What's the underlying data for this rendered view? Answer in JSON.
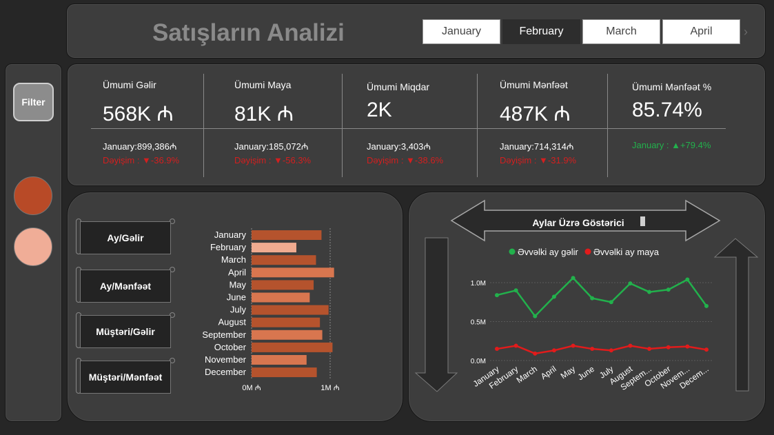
{
  "header": {
    "title": "Satışların Analizi",
    "tabs": [
      {
        "label": "January",
        "active": false
      },
      {
        "label": "February",
        "active": true
      },
      {
        "label": "March",
        "active": false
      },
      {
        "label": "April",
        "active": false
      }
    ],
    "next_icon": "›"
  },
  "sidebar": {
    "filter_label": "Filter",
    "circle_colors": [
      "#b84a27",
      "#f0ad97"
    ]
  },
  "kpis": [
    {
      "title": "Ümumi Gəlir",
      "value": "568K ₼",
      "prev": "January:899,386₼",
      "change": "Dəyişim : ▼-36.9%",
      "change_color": "#d31f1f"
    },
    {
      "title": "Ümumi Maya",
      "value": "81K ₼",
      "prev": "January:185,072₼",
      "change": "Dəyişim : ▼-56.3%",
      "change_color": "#d31f1f"
    },
    {
      "title": "Ümumi Miqdar",
      "value": "2K",
      "prev": "January:3,403₼",
      "change": "Dəyişim : ▼-38.6%",
      "change_color": "#d31f1f"
    },
    {
      "title": "Ümumi Mənfəət",
      "value": "487K ₼",
      "prev": "January:714,314₼",
      "change": "Dəyişim : ▼-31.9%",
      "change_color": "#d31f1f"
    },
    {
      "title": "Ümumi Mənfəət %",
      "value": "85.74%",
      "prev": "",
      "change": "January : ▲+79.4%",
      "change_color": "#22b14c"
    }
  ],
  "nav_buttons": [
    {
      "label": "Ay/Gəlir"
    },
    {
      "label": "Ay/Mənfəət"
    },
    {
      "label": "Müştəri/Gəlir"
    },
    {
      "label": "Müştəri/Mənfəət"
    }
  ],
  "chart_data": [
    {
      "type": "bar",
      "orientation": "horizontal",
      "categories": [
        "January",
        "February",
        "March",
        "April",
        "May",
        "June",
        "July",
        "August",
        "September",
        "October",
        "November",
        "December"
      ],
      "values": [
        0.89,
        0.57,
        0.82,
        1.05,
        0.79,
        0.74,
        0.98,
        0.87,
        0.9,
        1.03,
        0.7,
        0.83
      ],
      "value_unit": "M ₼",
      "colors": [
        "#b5532d",
        "#f0ab90",
        "#b5532d",
        "#d8764f",
        "#b5532d",
        "#d8764f",
        "#b5532d",
        "#b5532d",
        "#d8764f",
        "#b5532d",
        "#d8764f",
        "#b5532d"
      ],
      "xlim": [
        0,
        1.1
      ],
      "xticks": [
        "0M ₼",
        "1M ₼"
      ],
      "grid": true
    },
    {
      "type": "line",
      "title": "Aylar Üzrə Göstərici",
      "categories": [
        "January",
        "February",
        "March",
        "April",
        "May",
        "June",
        "July",
        "August",
        "Septem...",
        "October",
        "Novem...",
        "Decem..."
      ],
      "series": [
        {
          "name": "Əvvəlki ay gəlir",
          "color": "#22b14c",
          "values": [
            0.84,
            0.9,
            0.57,
            0.82,
            1.06,
            0.8,
            0.75,
            0.99,
            0.88,
            0.91,
            1.04,
            0.7
          ]
        },
        {
          "name": "Əvvəlki ay maya",
          "color": "#e21b1b",
          "values": [
            0.15,
            0.19,
            0.09,
            0.13,
            0.19,
            0.15,
            0.13,
            0.19,
            0.15,
            0.17,
            0.18,
            0.14
          ]
        }
      ],
      "yticks": [
        "0.0M",
        "0.5M",
        "1.0M"
      ],
      "ylim": [
        0,
        1.25
      ],
      "legend": "top"
    }
  ]
}
